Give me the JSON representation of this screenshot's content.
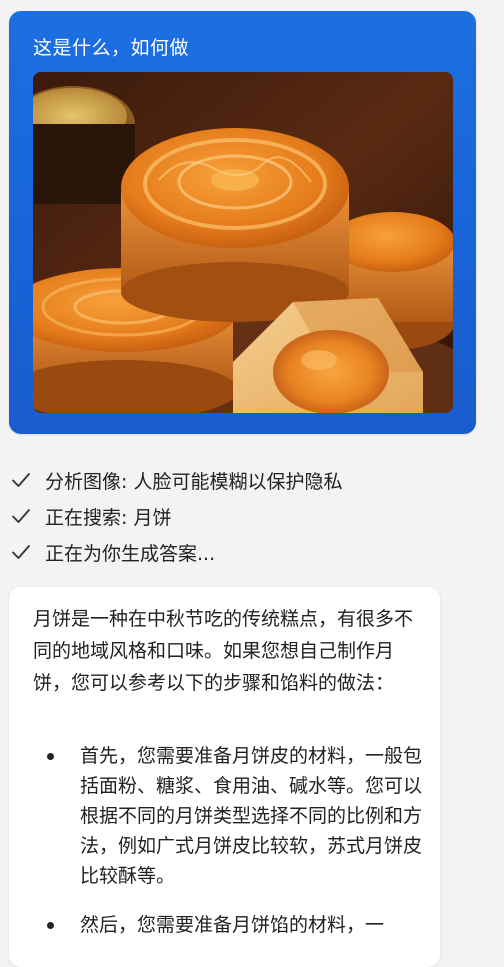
{
  "user_message": {
    "text": "这是什么，如何做",
    "image": "mooncake-photo"
  },
  "status_items": [
    {
      "icon": "check-icon",
      "text": "分析图像: 人脸可能模糊以保护隐私"
    },
    {
      "icon": "check-icon",
      "text": "正在搜索: 月饼"
    },
    {
      "icon": "check-icon",
      "text": "正在为你生成答案..."
    }
  ],
  "answer": {
    "intro": "月饼是一种在中秋节吃的传统糕点，有很多不同的地域风格和口味。如果您想自己制作月饼，您可以参考以下的步骤和馅料的做法：",
    "bullets": [
      "首先，您需要准备月饼皮的材料，一般包括面粉、糖浆、食用油、碱水等。您可以根据不同的月饼类型选择不同的比例和方法，例如广式月饼皮比较软，苏式月饼皮比较酥等。",
      "然后，您需要准备月饼馅的材料，一"
    ]
  },
  "colors": {
    "bubble_blue": "#1c6fe2",
    "page_background": "#f3f3f3",
    "card_background": "#ffffff"
  }
}
